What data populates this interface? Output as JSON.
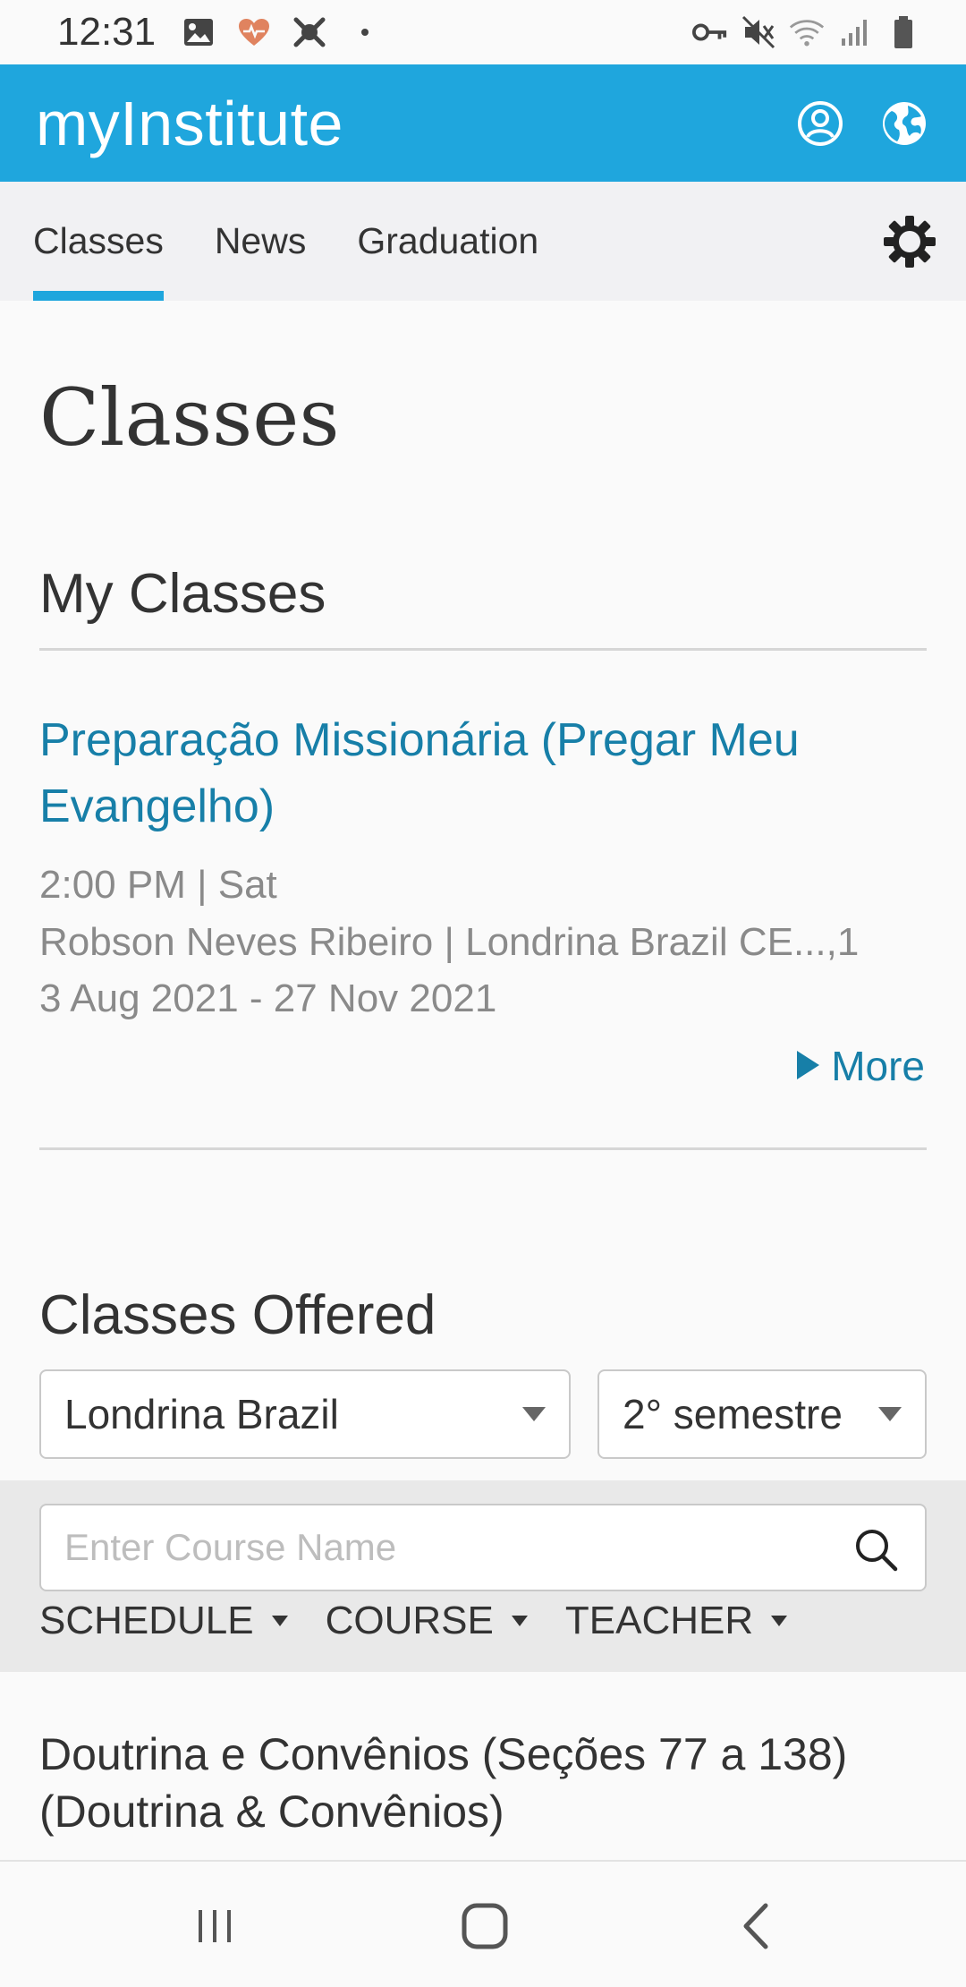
{
  "status_bar": {
    "time": "12:31",
    "left_icons": [
      "gallery-icon",
      "health-icon",
      "app-icon",
      "dot-icon"
    ],
    "right_icons": [
      "vpn-key-icon",
      "mute-icon",
      "wifi-icon",
      "signal-icon",
      "battery-icon"
    ]
  },
  "header": {
    "app_title": "myInstitute",
    "icons": [
      "account-icon",
      "globe-icon"
    ],
    "accent_color": "#1fa6dd"
  },
  "tabs": [
    {
      "label": "Classes",
      "active": true
    },
    {
      "label": "News",
      "active": false
    },
    {
      "label": "Graduation",
      "active": false
    }
  ],
  "main": {
    "page_title": "Classes",
    "my_classes": {
      "heading": "My Classes",
      "class": {
        "title": "Preparação Missionária (Pregar Meu Evangelho)",
        "schedule": "2:00 PM | Sat",
        "teacher_location": "Robson Neves Ribeiro | Londrina Brazil CE...,1",
        "dates": "3 Aug 2021 - 27 Nov 2021",
        "more_label": "More"
      }
    },
    "classes_offered": {
      "heading": "Classes Offered",
      "location_select": "Londrina Brazil",
      "term_select": "2° semestre",
      "search_placeholder": "Enter Course Name",
      "filters": [
        "SCHEDULE",
        "COURSE",
        "TEACHER"
      ],
      "first_course": "Doutrina e Convênios (Seções 77 a 138) (Doutrina & Convênios)"
    },
    "link_color": "#177fa8"
  },
  "nav_bar": {
    "icons": [
      "recent-apps-icon",
      "home-icon",
      "back-icon"
    ]
  }
}
